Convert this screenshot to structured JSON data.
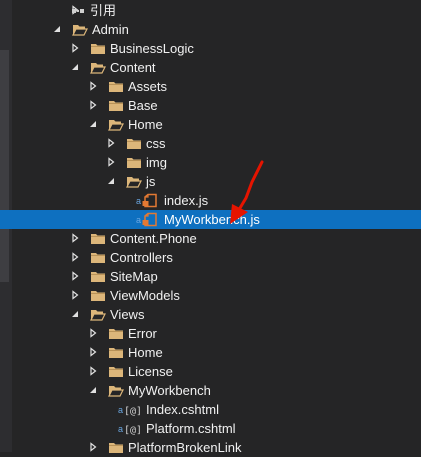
{
  "colors": {
    "background": "#252526",
    "selection": "#0e70c0",
    "folder": "#dcb67a",
    "js_file": "#e37933",
    "cshtml_file": "#4fa3e0",
    "annotation_arrow": "#e51400"
  },
  "tree": [
    {
      "label": "引用",
      "icon": "references-icon",
      "toggle": "collapsed",
      "depth": 3
    },
    {
      "label": "Admin",
      "icon": "folder-open-icon",
      "toggle": "expanded",
      "depth": 2
    },
    {
      "label": "BusinessLogic",
      "icon": "folder-icon",
      "toggle": "collapsed",
      "depth": 3
    },
    {
      "label": "Content",
      "icon": "folder-open-icon",
      "toggle": "expanded",
      "depth": 3
    },
    {
      "label": "Assets",
      "icon": "folder-icon",
      "toggle": "collapsed",
      "depth": 4
    },
    {
      "label": "Base",
      "icon": "folder-icon",
      "toggle": "collapsed",
      "depth": 4
    },
    {
      "label": "Home",
      "icon": "folder-open-icon",
      "toggle": "expanded",
      "depth": 4
    },
    {
      "label": "css",
      "icon": "folder-icon",
      "toggle": "collapsed",
      "depth": 5
    },
    {
      "label": "img",
      "icon": "folder-icon",
      "toggle": "collapsed",
      "depth": 5
    },
    {
      "label": "js",
      "icon": "folder-open-icon",
      "toggle": "expanded",
      "depth": 5
    },
    {
      "label": "index.js",
      "icon": "js-file-icon",
      "toggle": "none",
      "depth": 6
    },
    {
      "label": "MyWorkbench.js",
      "icon": "js-file-icon",
      "toggle": "none",
      "depth": 6,
      "selected": true
    },
    {
      "label": "Content.Phone",
      "icon": "folder-icon",
      "toggle": "collapsed",
      "depth": 3
    },
    {
      "label": "Controllers",
      "icon": "folder-icon",
      "toggle": "collapsed",
      "depth": 3
    },
    {
      "label": "SiteMap",
      "icon": "folder-icon",
      "toggle": "collapsed",
      "depth": 3
    },
    {
      "label": "ViewModels",
      "icon": "folder-icon",
      "toggle": "collapsed",
      "depth": 3
    },
    {
      "label": "Views",
      "icon": "folder-open-icon",
      "toggle": "expanded",
      "depth": 3
    },
    {
      "label": "Error",
      "icon": "folder-icon",
      "toggle": "collapsed",
      "depth": 4
    },
    {
      "label": "Home",
      "icon": "folder-icon",
      "toggle": "collapsed",
      "depth": 4
    },
    {
      "label": "License",
      "icon": "folder-icon",
      "toggle": "collapsed",
      "depth": 4
    },
    {
      "label": "MyWorkbench",
      "icon": "folder-open-icon",
      "toggle": "expanded",
      "depth": 4
    },
    {
      "label": "Index.cshtml",
      "icon": "cshtml-file-icon",
      "toggle": "none",
      "depth": 5
    },
    {
      "label": "Platform.cshtml",
      "icon": "cshtml-file-icon",
      "toggle": "none",
      "depth": 5
    },
    {
      "label": "PlatformBrokenLink",
      "icon": "folder-icon",
      "toggle": "collapsed",
      "depth": 4
    }
  ]
}
